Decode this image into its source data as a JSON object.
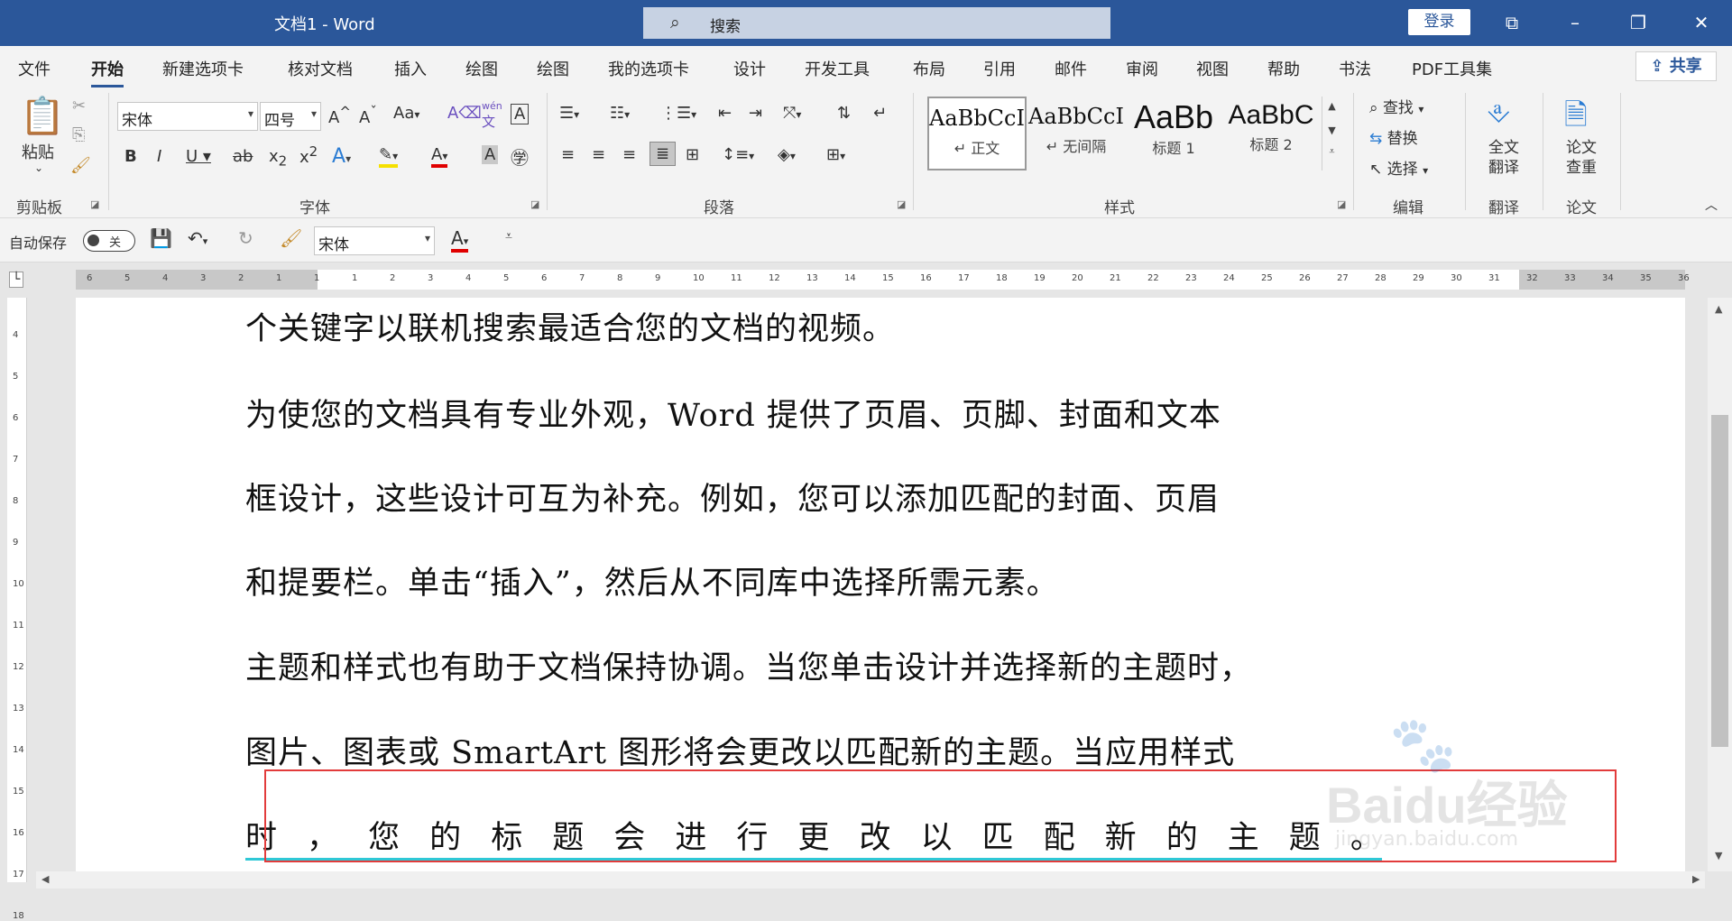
{
  "window": {
    "title": "文档1 - Word",
    "search_placeholder": "搜索",
    "login_label": "登录"
  },
  "tabs": [
    "文件",
    "开始",
    "新建选项卡",
    "核对文档",
    "插入",
    "绘图",
    "绘图",
    "我的选项卡",
    "设计",
    "开发工具",
    "布局",
    "引用",
    "邮件",
    "审阅",
    "视图",
    "帮助",
    "书法",
    "PDF工具集"
  ],
  "active_tab": "开始",
  "share_label": "共享",
  "ribbon": {
    "clipboard": {
      "paste_label": "粘贴",
      "group_label": "剪贴板"
    },
    "font": {
      "font_name": "宋体",
      "font_size": "四号",
      "group_label": "字体",
      "aa_label": "Aa",
      "wen_label": "wén",
      "wen_char": "文"
    },
    "paragraph": {
      "group_label": "段落"
    },
    "styles": {
      "group_label": "样式",
      "items": [
        {
          "preview": "AaBbCcI",
          "name": "↵ 正文"
        },
        {
          "preview": "AaBbCcI",
          "name": "↵ 无间隔"
        },
        {
          "preview": "AaBb",
          "name": "标题 1"
        },
        {
          "preview": "AaBbC",
          "name": "标题 2"
        }
      ]
    },
    "editing": {
      "find_label": "查找",
      "replace_label": "替换",
      "select_label": "选择",
      "group_label": "编辑"
    },
    "translate": {
      "button_label_1": "全文",
      "button_label_2": "翻译",
      "group_label": "翻译"
    },
    "thesis": {
      "button_label_1": "论文",
      "button_label_2": "查重",
      "group_label": "论文"
    }
  },
  "qat": {
    "autosave_label": "自动保存",
    "autosave_state": "关",
    "font_name": "宋体"
  },
  "ruler": {
    "h_ticks": [
      "6",
      "5",
      "4",
      "3",
      "2",
      "1",
      "1",
      "1",
      "2",
      "3",
      "4",
      "5",
      "6",
      "7",
      "8",
      "9",
      "10",
      "11",
      "12",
      "13",
      "14",
      "15",
      "16",
      "17",
      "18",
      "19",
      "20",
      "21",
      "22",
      "23",
      "24",
      "25",
      "26",
      "27",
      "28",
      "29",
      "30",
      "31",
      "32",
      "33",
      "34",
      "35",
      "36"
    ],
    "v_ticks": [
      "4",
      "5",
      "6",
      "7",
      "8",
      "9",
      "10",
      "11",
      "12",
      "13",
      "14",
      "15",
      "16",
      "17",
      "18"
    ]
  },
  "document": {
    "lines": [
      "个关键字以联机搜索最适合您的文档的视频。",
      "为使您的文档具有专业外观，Word 提供了页眉、页脚、封面和文本",
      "框设计，这些设计可互为补充。例如，您可以添加匹配的封面、页眉",
      "和提要栏。单击“插入”，然后从不同库中选择所需元素。",
      "主题和样式也有助于文档保持协调。当您单击设计并选择新的主题时，",
      "图片、图表或 SmartArt 图形将会更改以匹配新的主题。当应用样式"
    ],
    "justified_chars": [
      "时",
      "，",
      "您",
      "的",
      "标",
      "题",
      "会",
      "进",
      "行",
      "更",
      "改",
      "以",
      "匹",
      "配",
      "新",
      "的",
      "主",
      "题",
      "。"
    ]
  },
  "watermark": {
    "brand": "Baidu",
    "brand_cn": "经验",
    "url": "jingyan.baidu.com"
  },
  "colors": {
    "title_bar": "#2b579a",
    "highlight_box": "#e23b3b",
    "underline": "#2fc8d6"
  }
}
